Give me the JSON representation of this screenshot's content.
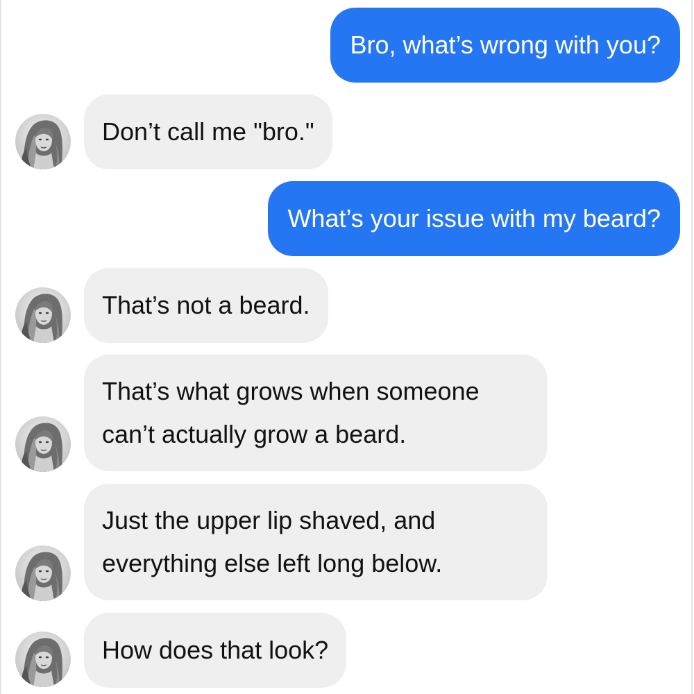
{
  "messages": [
    {
      "id": "m1",
      "direction": "sent",
      "text": "Bro, what’s wrong with you?"
    },
    {
      "id": "m2",
      "direction": "received",
      "text": "Don’t call me \"bro.\""
    },
    {
      "id": "m3",
      "direction": "sent",
      "text": "What’s your issue with my beard?"
    },
    {
      "id": "m4",
      "direction": "received",
      "text": "That’s not a beard."
    },
    {
      "id": "m5",
      "direction": "received",
      "lines": [
        "That’s what grows when someone",
        "can’t actually grow a beard."
      ]
    },
    {
      "id": "m6",
      "direction": "received",
      "lines": [
        "Just the upper lip shaved, and",
        "everything else left long below."
      ]
    },
    {
      "id": "m7",
      "direction": "received",
      "text": "How does that look?"
    }
  ],
  "colors": {
    "sent_bubble": "#2576f2",
    "received_bubble": "#efefef",
    "sent_text": "#ffffff",
    "received_text": "#111111"
  },
  "icons": {
    "avatar": "contact-avatar-photo"
  }
}
